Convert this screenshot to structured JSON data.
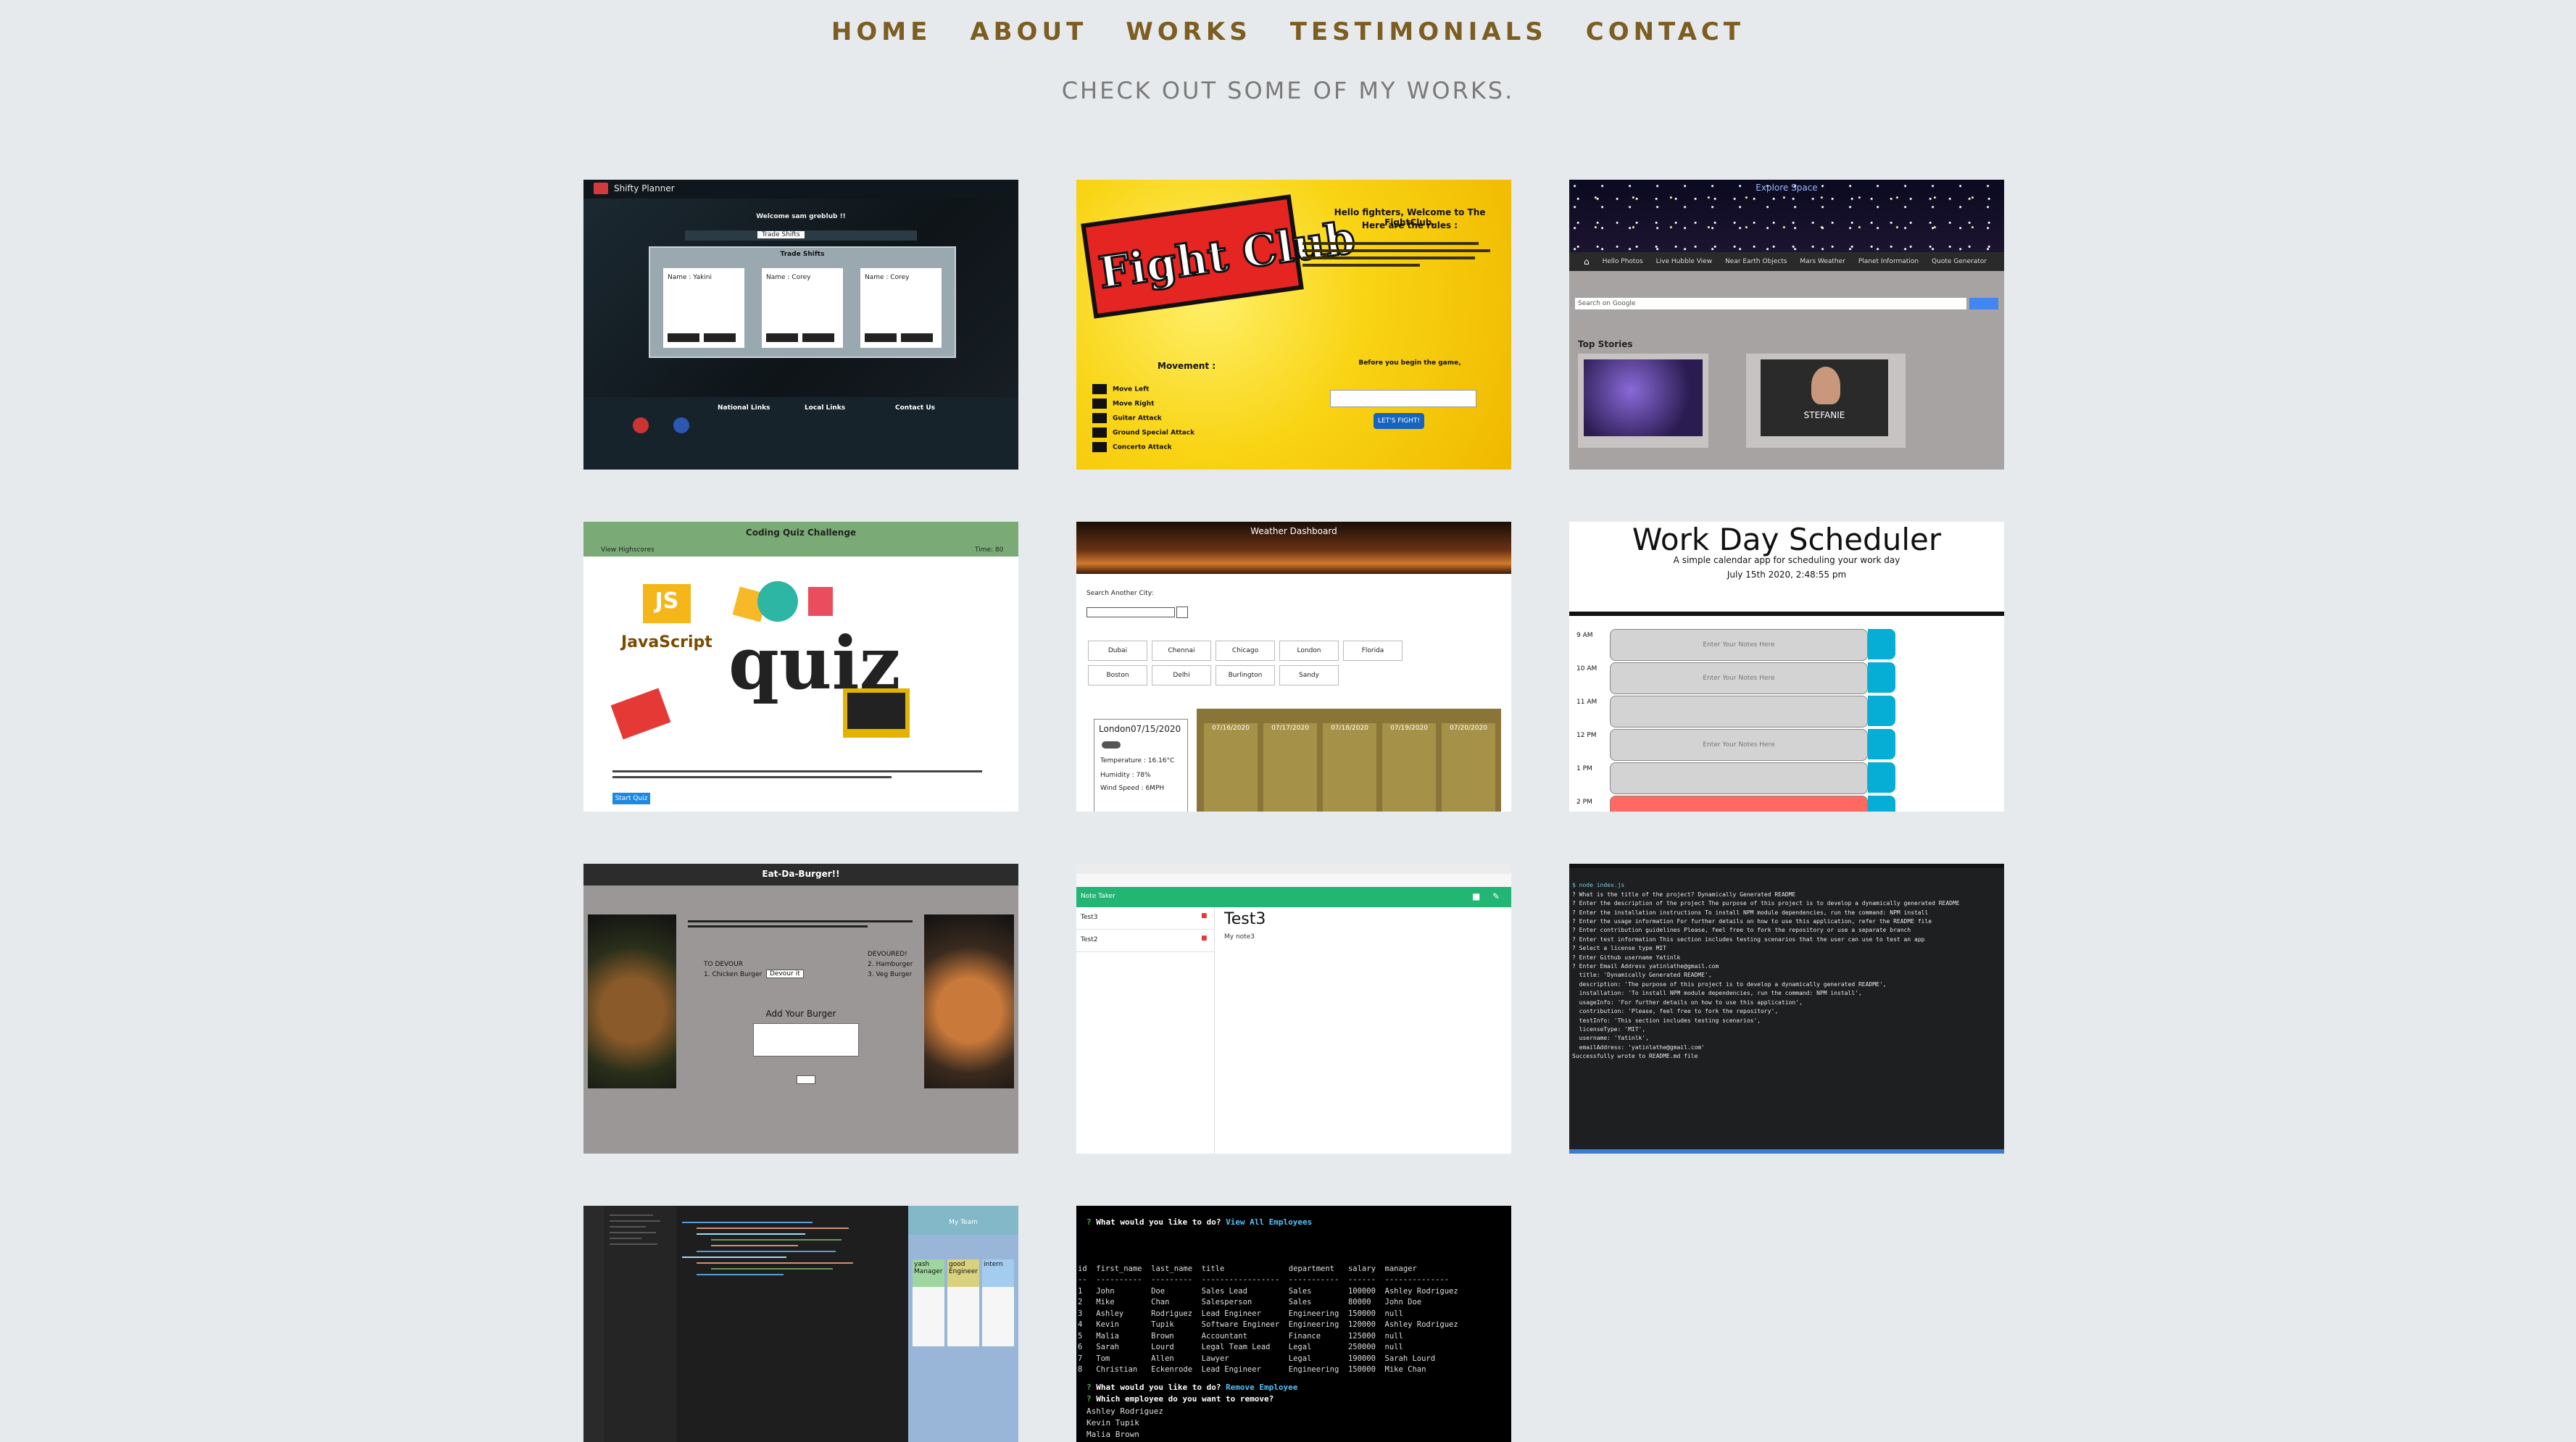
{
  "nav": {
    "items": [
      "HOME",
      "ABOUT",
      "WORKS",
      "TESTIMONIALS",
      "CONTACT"
    ]
  },
  "subtitle": "CHECK OUT SOME OF MY WORKS.",
  "works": {
    "shifty": {
      "brand": "Shifty Planner",
      "welcome": "Welcome sam greblub !!",
      "tab": "Trade Shifts",
      "panel_title": "Trade Shifts",
      "cards": [
        "Name : Yakini",
        "Name : Corey",
        "Name : Corey"
      ],
      "footer_cols": [
        "National Links",
        "Local Links",
        "Contact Us"
      ]
    },
    "fight": {
      "logo": "Fight Club",
      "welcome": "Hello fighters, Welcome to The FightClub.",
      "rules": "Here are the rules :",
      "movement": "Movement :",
      "moves": [
        "Move Left",
        "Move Right",
        "Guitar Attack",
        "Ground Special Attack",
        "Concerto Attack"
      ],
      "prompt": "Before you begin the game,",
      "cta": "LET'S FIGHT!"
    },
    "space": {
      "title": "Explore Space",
      "menu": [
        "Hello Photos",
        "Live Hubble View",
        "Near Earth Objects",
        "Mars Weather",
        "Planet Information",
        "Quote Generator"
      ],
      "search_placeholder": "Search on Google",
      "top_stories": "Top Stories",
      "video_caption": "STEFANIE"
    },
    "quiz": {
      "title": "Coding Quiz Challenge",
      "highscores": "View Highscores",
      "timer": "Time: 80",
      "js_label": "JS",
      "js_word": "JavaScript",
      "quiz_word": "quiz",
      "start": "Start Quiz"
    },
    "weather": {
      "title": "Weather Dashboard",
      "search_label": "Search Another City:",
      "cities": [
        "Dubai",
        "Chennai",
        "Chicago",
        "London",
        "Florida",
        "Boston",
        "Delhi",
        "Burlington",
        "Sandy"
      ],
      "current_city": "London07/15/2020",
      "current_lines": [
        "Temperature : 16.16°C",
        "Humidity : 78%",
        "Wind Speed : 6MPH"
      ],
      "forecast_dates": [
        "07/16/2020",
        "07/17/2020",
        "07/18/2020",
        "07/19/2020",
        "07/20/2020"
      ]
    },
    "scheduler": {
      "title": "Work Day Scheduler",
      "subtitle": "A simple calendar app for scheduling your work day",
      "date": "July 15th 2020, 2:48:55 pm",
      "hours": [
        "9 AM",
        "10 AM",
        "11 AM",
        "12 PM",
        "1 PM",
        "2 PM"
      ],
      "placeholder": "Enter Your Notes Here"
    },
    "burger": {
      "title": "Eat-Da-Burger!!",
      "to_devour": "TO DEVOUR",
      "devoured": "DEVOURED!",
      "add": "Add Your Burger",
      "devour_btn": "Devour it",
      "item_left": "1. Chicken Burger",
      "items_right": [
        "2. Hamburger",
        "3. Veg Burger"
      ]
    },
    "notes": {
      "app_title": "Note Taker",
      "list": [
        "Test3",
        "Test2"
      ],
      "note_title": "Test3",
      "note_body": "My note3"
    },
    "readme": {
      "lines": [
        "$ node index.js",
        "? What is the title of the project? Dynamically Generated README",
        "? Enter the description of the project The purpose of this project is to develop a dynamically generated README",
        "? Enter the installation instructions To install NPM module dependencies, run the command: NPM install",
        "? Enter the usage information For further details on how to use this application, refer the README file",
        "? Enter contribution guidelines Please, feel free to fork the repository or use a separate branch",
        "? Enter test information This section includes testing scenarios that the user can use to test an app",
        "? Select a license type MIT",
        "? Enter Github username Yatinlk",
        "? Enter Email Address yatinlathe@gmail.com",
        "",
        "  title: 'Dynamically Generated README',",
        "  description: 'The purpose of this project is to develop a dynamically generated README',",
        "  installation: 'To install NPM module dependencies, run the command: NPM install',",
        "  usageInfo: 'For further details on how to use this application',",
        "  contribution: 'Please, feel free to fork the repository',",
        "  testInfo: 'This section includes testing scenarios',",
        "  licenseType: 'MIT',",
        "  username: 'Yatinlk',",
        "  emailAddress: 'yatinlathe@gmail.com'",
        "",
        "Successfully wrote to README.md file"
      ]
    },
    "employee": {
      "prompt": "What would you like to do?",
      "choice": "View All Employees",
      "header": "id  first_name  last_name  title              department   salary  manager",
      "rule": "--  ----------  ---------  -----------------  -----------  ------  --------------",
      "rows": [
        "1   John        Doe        Sales Lead         Sales        100000  Ashley Rodriguez",
        "2   Mike        Chan       Salesperson        Sales        80000   John Doe",
        "3   Ashley      Rodriguez  Lead Engineer      Engineering  150000  null",
        "4   Kevin       Tupik      Software Engineer  Engineering  120000  Ashley Rodriguez",
        "5   Malia       Brown      Accountant         Finance      125000  null",
        "6   Sarah       Lourd      Legal Team Lead    Legal        250000  null",
        "7   Tom         Allen      Lawyer             Legal        190000  Sarah Lourd",
        "8   Christian   Eckenrode  Lead Engineer      Engineering  150000  Mike Chan"
      ],
      "prompt2": "What would you like to do?",
      "choice2": "Remove Employee",
      "question": "Which employee do you want to remove?",
      "options": [
        "Ashley Rodriguez",
        "Kevin Tupik",
        "Malia Brown"
      ]
    },
    "code": {
      "board_title": "My Team",
      "cards": [
        "yash Manager",
        "good Engineer",
        "intern"
      ]
    }
  }
}
